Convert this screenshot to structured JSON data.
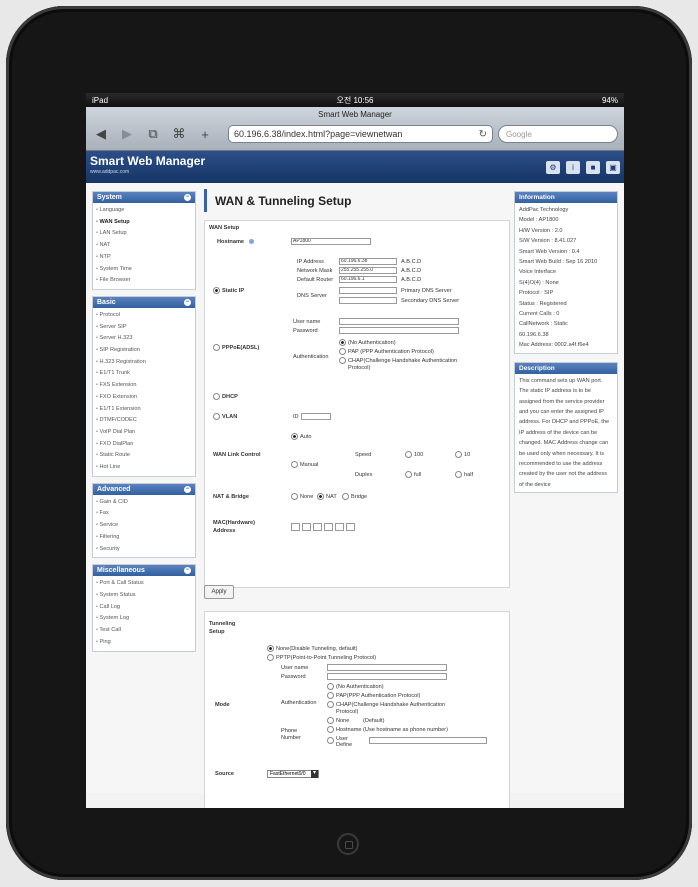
{
  "device": {
    "carrier": "iPad",
    "time": "오전 10:56",
    "battery": "94%"
  },
  "browser": {
    "page_title": "Smart Web Manager",
    "url": "60.196.6.38/index.html?page=viewnetwan",
    "search_placeholder": "Google"
  },
  "header": {
    "logo": "Smart Web Manager",
    "logo_sub": "www.addpac.com"
  },
  "sidebar": [
    {
      "title": "System",
      "items": [
        "Language",
        "WAN Setup",
        "LAN Setup",
        "NAT",
        "NTP",
        "System Time",
        "File Browser"
      ],
      "active": 1
    },
    {
      "title": "Basic",
      "items": [
        "Protocol",
        "Server SIP",
        "Server H.323",
        "SIP Registration",
        "H.323 Registration",
        "E1/T1 Trunk",
        "FXS Extension",
        "FXO Extension",
        "E1/T1 Extension",
        "DTMF/CODEC",
        "VoIP Dial Plan",
        "FXO DialPlan",
        "Static Route",
        "Hot Line"
      ]
    },
    {
      "title": "Advanced",
      "items": [
        "Gain & CID",
        "Fax",
        "Service",
        "Filtering",
        "Security"
      ]
    },
    {
      "title": "Miscellaneous",
      "items": [
        "Port & Call Status",
        "System Status",
        "Call Log",
        "System Log",
        "Test Call",
        "Ping"
      ]
    }
  ],
  "main": {
    "title": "WAN & Tunneling Setup",
    "wan_setup": "WAN Setup",
    "hostname_label": "Hostname",
    "hostname": "AP1800",
    "static_ip": "Static IP",
    "ip_label": "IP Address",
    "ip": "60.196.6.38",
    "mask_label": "Network Mask",
    "mask": "255.255.255.0",
    "router_label": "Default Router",
    "router": "60.196.6.1",
    "abcd": "A.B.C.D",
    "dns_label": "DNS Server",
    "dns_primary": "Primary DNS Server",
    "dns_secondary": "Secondary DNS Server",
    "pppoe": "PPPoE(ADSL)",
    "user_name": "User name",
    "password": "Password",
    "authentication": "Authentication",
    "auth_none": "(No Authentication)",
    "auth_pap": "PAP (PPP Authentication Protocol)",
    "auth_chap": "CHAP(Challenge Handshake Authentication Protocol)",
    "dhcp": "DHCP",
    "vlan": "VLAN",
    "id_label": "ID",
    "link_control": "WAN Link Control",
    "auto": "Auto",
    "manual": "Manual",
    "speed": "Speed",
    "s100": "100",
    "s10": "10",
    "duplex": "Duplex",
    "full": "full",
    "half": "half",
    "nat_bridge": "NAT & Bridge",
    "nb_none": "None",
    "nb_nat": "NAT",
    "nb_bridge": "Bridge",
    "mac": "MAC(Hardware) Address",
    "apply": "Apply",
    "tunneling": "Tunneling Setup",
    "t_none": "None(Disable Tunneling, default)",
    "t_pptp": "PPTP(Point-to-Point Tunneling Protocol)",
    "mode": "Mode",
    "t_auth_none": "(No Authentication)",
    "t_auth_pap": "PAP(PPP Authentication Protocol)",
    "t_auth_chap": "CHAP(Challenge Handshake Authentication Protocol)",
    "phone_number": "Phone Number",
    "pn_none": "None",
    "pn_default": "(Default)",
    "pn_hostname": "Hostname (Use hostname as phone number)",
    "pn_user": "User Define",
    "source": "Source",
    "source_value": "FastEthernet0/0"
  },
  "info": {
    "title": "Information",
    "lines": "AddPac Technology\nModel : AP1800\nH/W Version : 2.0\nS/W Version : 8.41.027\nSmart Web Version : 0.4\nSmart Web Build : Sep 16 2010\nVoice Interface\n    S(4)O(4) : None\nProtocol : SIP\nStatus : Registered\nCurrent Calls : 0\nCallNetwork : Static\n60.196.6.38\nMac Address: 0002.a4f.f6e4",
    "desc_title": "Description",
    "desc": "This command sets up WAN port. The static IP address is to be assigned from the service provider and you can enter the assigned IP address. For DHCP and PPPoE, the IP address of the device can be changed. MAC Address change can be used only when necessary. It is recommended to use the address created by the user not the address of the device"
  }
}
